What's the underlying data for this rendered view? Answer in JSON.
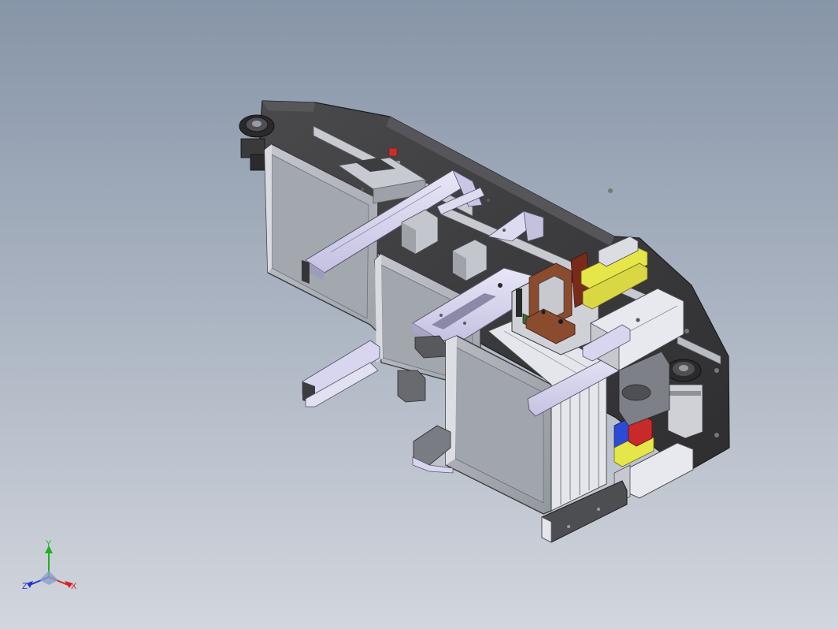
{
  "triad": {
    "x_label": "X",
    "y_label": "Y",
    "z_label": "Z"
  },
  "colors": {
    "background_top": "#8795a8",
    "background_bottom": "#d2d6dd",
    "base_plate": "#3b3b3d",
    "panel_grey": "#a9adb4",
    "panel_light": "#e3e4ea",
    "arm_lavender": "#d6d4ee",
    "rail_yellow": "#e6e54a",
    "part_brown": "#8a4b2e",
    "part_green": "#3a6b3a",
    "part_blue": "#2b4bd6",
    "part_red": "#c82a2a",
    "axis_x": "#d62020",
    "axis_y": "#20b020",
    "axis_z": "#2030d0"
  }
}
